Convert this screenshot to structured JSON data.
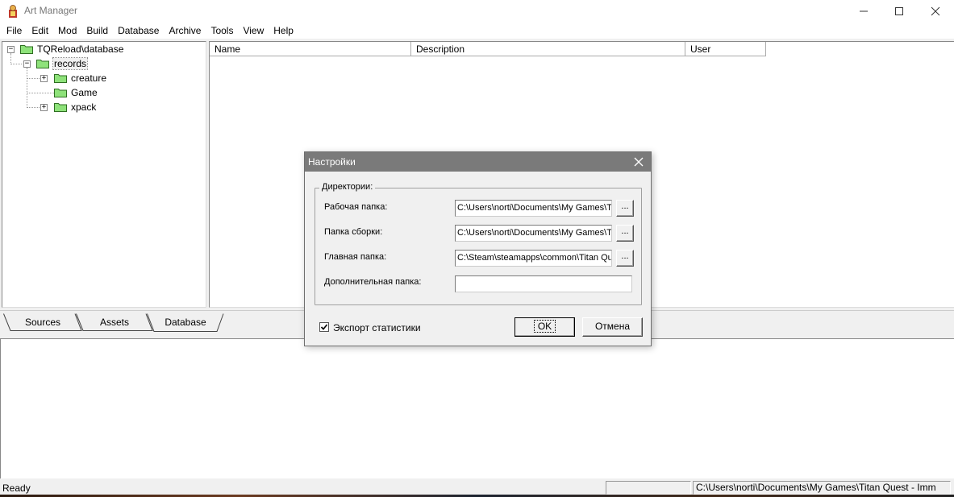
{
  "window": {
    "title": "Art Manager",
    "icon": "art-manager-app-icon"
  },
  "menu": [
    "File",
    "Edit",
    "Mod",
    "Build",
    "Database",
    "Archive",
    "Tools",
    "View",
    "Help"
  ],
  "tree": {
    "root": "TQReload\\database",
    "records": "records",
    "children": [
      "creature",
      "Game",
      "xpack"
    ]
  },
  "list": {
    "columns": [
      "Name",
      "Description",
      "User"
    ]
  },
  "tabs": [
    "Sources",
    "Assets",
    "Database"
  ],
  "status": {
    "text": "Ready",
    "cell1": "",
    "path": "C:\\Users\\norti\\Documents\\My Games\\Titan Quest - Imm"
  },
  "dialog": {
    "title": "Настройки",
    "group_label": "Директории:",
    "fields": [
      {
        "label": "Рабочая папка:",
        "value": "C:\\Users\\norti\\Documents\\My Games\\Titan Quest"
      },
      {
        "label": "Папка сборки:",
        "value": "C:\\Users\\norti\\Documents\\My Games\\Titan Quest"
      },
      {
        "label": "Главная папка:",
        "value": "C:\\Steam\\steamapps\\common\\Titan Quest"
      },
      {
        "label": "Дополнительная папка:",
        "value": ""
      }
    ],
    "browse_label": "...",
    "checkbox_label": "Экспорт статистики",
    "checkbox_checked": true,
    "ok_label": "OK",
    "cancel_label": "Отмена"
  },
  "colors": {
    "folder_fill": "#8ee27a",
    "folder_stroke": "#2f6e22",
    "dialog_title_bg": "#7a7a7a"
  }
}
